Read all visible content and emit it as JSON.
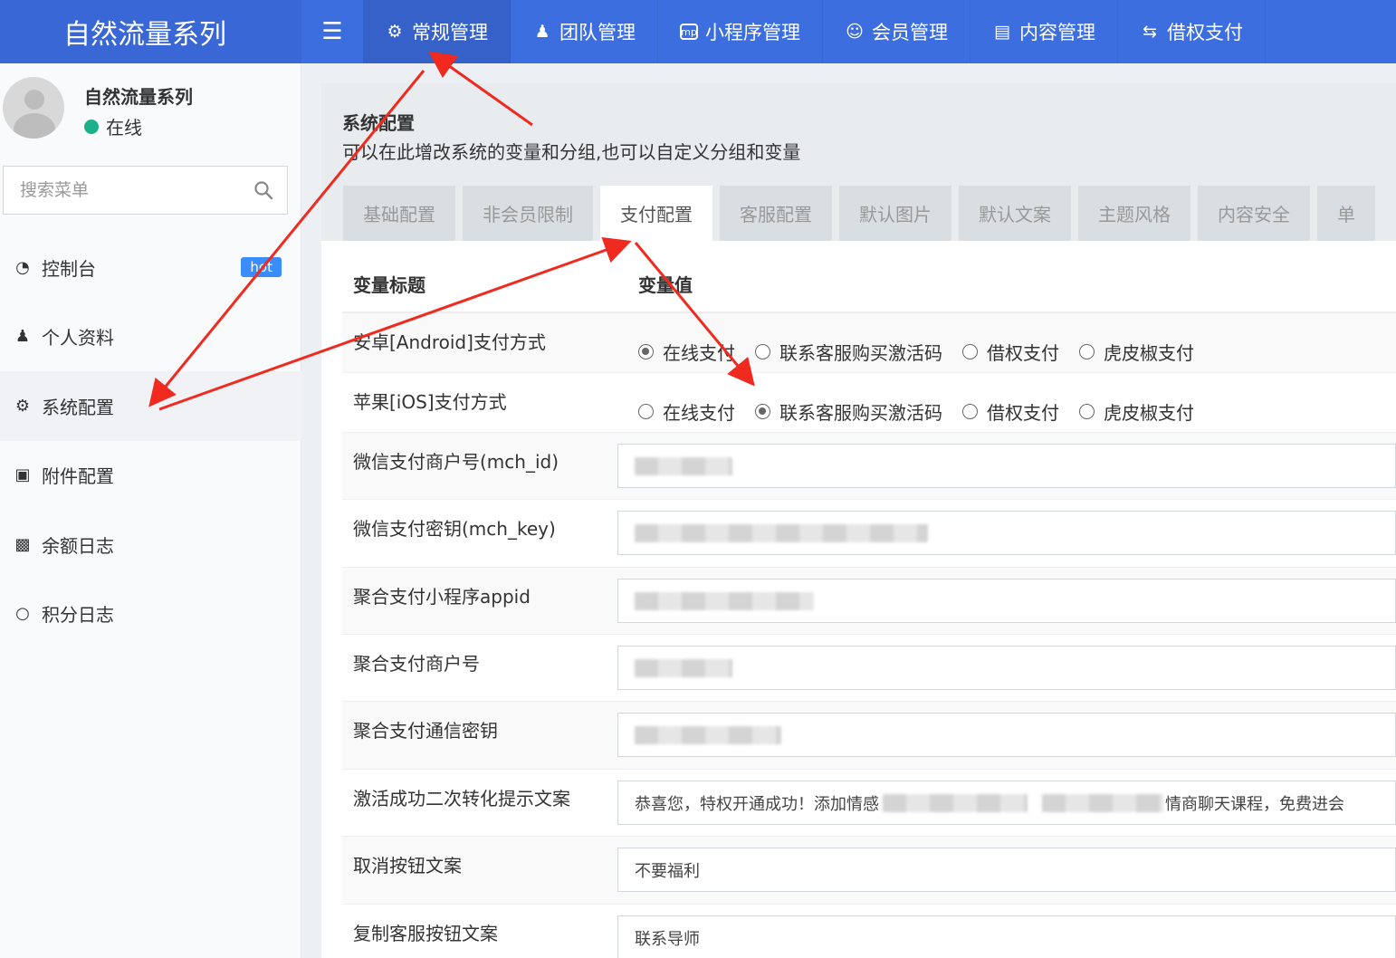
{
  "header": {
    "brand": "自然流量系列",
    "nav": [
      {
        "label": "常规管理",
        "icon": "gears-icon",
        "active": true
      },
      {
        "label": "团队管理",
        "icon": "users-icon"
      },
      {
        "label": "小程序管理",
        "icon": "miniprogram-icon"
      },
      {
        "label": "会员管理",
        "icon": "user-circle-icon"
      },
      {
        "label": "内容管理",
        "icon": "newspaper-icon"
      },
      {
        "label": "借权支付",
        "icon": "exchange-icon"
      }
    ]
  },
  "sidebar": {
    "user_name": "自然流量系列",
    "user_status": "在线",
    "search_placeholder": "搜索菜单",
    "items": [
      {
        "label": "控制台",
        "icon": "dashboard-icon",
        "badge": "hot"
      },
      {
        "label": "个人资料",
        "icon": "user-icon"
      },
      {
        "label": "系统配置",
        "icon": "gear-icon",
        "active": true
      },
      {
        "label": "附件配置",
        "icon": "image-icon"
      },
      {
        "label": "余额日志",
        "icon": "money-icon"
      },
      {
        "label": "积分日志",
        "icon": "circle-icon"
      }
    ]
  },
  "main": {
    "title": "系统配置",
    "description": "可以在此增改系统的变量和分组,也可以自定义分组和变量",
    "tabs": [
      "基础配置",
      "非会员限制",
      "支付配置",
      "客服配置",
      "默认图片",
      "默认文案",
      "主题风格",
      "内容安全",
      "单"
    ],
    "active_tab": "支付配置",
    "table": {
      "col_title": "变量标题",
      "col_value": "变量值",
      "radio_options": [
        "在线支付",
        "联系客服购买激活码",
        "借权支付",
        "虎皮椒支付"
      ],
      "rows": [
        {
          "label": "安卓[Android]支付方式",
          "type": "radio",
          "selected": "在线支付"
        },
        {
          "label": "苹果[iOS]支付方式",
          "type": "radio",
          "selected": "联系客服购买激活码"
        },
        {
          "label": "微信支付商户号(mch_id)",
          "type": "text",
          "value": ""
        },
        {
          "label": "微信支付密钥(mch_key)",
          "type": "text",
          "value": ""
        },
        {
          "label": "聚合支付小程序appid",
          "type": "text",
          "value": ""
        },
        {
          "label": "聚合支付商户号",
          "type": "text",
          "value": ""
        },
        {
          "label": "聚合支付通信密钥",
          "type": "text",
          "value": ""
        },
        {
          "label": "激活成功二次转化提示文案",
          "type": "text",
          "value": "恭喜您，特权开通成功！添加情感",
          "value_suffix": "情商聊天课程，免费进会"
        },
        {
          "label": "取消按钮文案",
          "type": "text",
          "value": "不要福利"
        },
        {
          "label": "复制客服按钮文案",
          "type": "text",
          "value": "联系导师"
        }
      ]
    }
  },
  "colors": {
    "header": "#3c6ee0",
    "badge": "#3c8dfc",
    "online": "#1cb08a",
    "annotation_arrow": "#f02a1f"
  }
}
